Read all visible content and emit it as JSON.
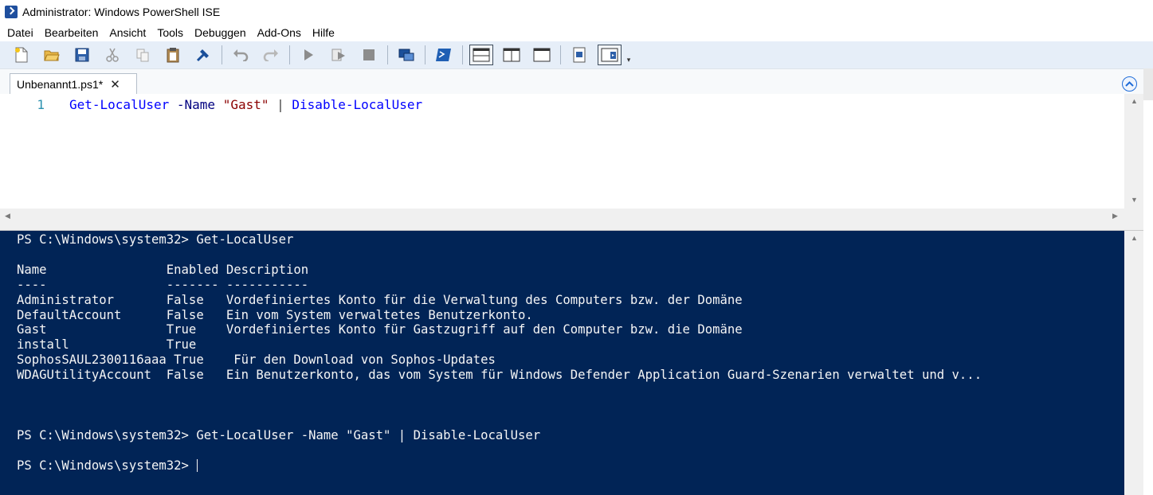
{
  "window": {
    "title": "Administrator: Windows PowerShell ISE"
  },
  "menu": {
    "items": [
      "Datei",
      "Bearbeiten",
      "Ansicht",
      "Tools",
      "Debuggen",
      "Add-Ons",
      "Hilfe"
    ]
  },
  "toolbar": {
    "icons": [
      "new-file-icon",
      "open-folder-icon",
      "save-icon",
      "cut-icon",
      "copy-icon",
      "paste-icon",
      "clear-console-icon",
      "undo-icon",
      "redo-icon",
      "run-script-icon",
      "run-selection-icon",
      "stop-icon",
      "remote-powershell-icon",
      "start-powershell-icon",
      "show-script-pane-top-icon",
      "show-script-pane-right-icon",
      "show-script-pane-maximized-icon",
      "show-command-window-icon",
      "show-command-addon-icon"
    ]
  },
  "tabs": [
    {
      "label": "Unbenannt1.ps1*",
      "close": "✕"
    }
  ],
  "editor": {
    "line_number": "1",
    "tokens": {
      "cmd1": "Get-LocalUser",
      "param": "-Name",
      "string": "\"Gast\"",
      "pipe": "|",
      "cmd2": "Disable-LocalUser"
    }
  },
  "console": {
    "prompt1": "PS C:\\Windows\\system32> Get-LocalUser",
    "header": "Name                Enabled Description",
    "underline": "----                ------- -----------",
    "rows": [
      "Administrator       False   Vordefiniertes Konto für die Verwaltung des Computers bzw. der Domäne",
      "DefaultAccount      False   Ein vom System verwaltetes Benutzerkonto.",
      "Gast                True    Vordefiniertes Konto für Gastzugriff auf den Computer bzw. die Domäne",
      "install             True",
      "SophosSAUL2300116aaa True    Für den Download von Sophos-Updates",
      "WDAGUtilityAccount  False   Ein Benutzerkonto, das vom System für Windows Defender Application Guard-Szenarien verwaltet und v..."
    ],
    "prompt2": "PS C:\\Windows\\system32> Get-LocalUser -Name \"Gast\" | Disable-LocalUser",
    "prompt3": "PS C:\\Windows\\system32> "
  },
  "colors": {
    "console_bg": "#012456",
    "console_fg": "#f5f5f5",
    "toolbar_bg": "#e6eef8",
    "cmdlet": "#0000ff",
    "parameter": "#000080",
    "string": "#8b0000",
    "line_number": "#2b91af"
  }
}
